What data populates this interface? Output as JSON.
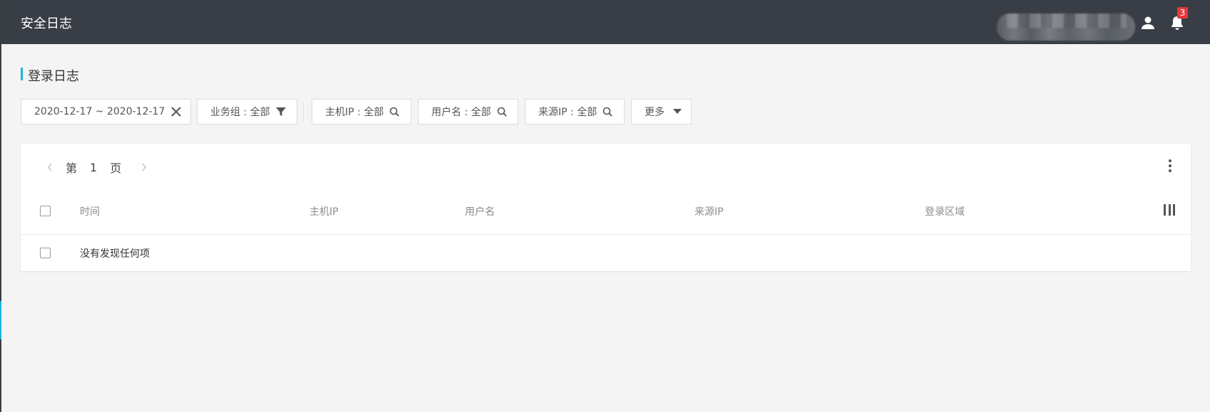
{
  "app": {
    "title": "安全日志",
    "notification_count": "3"
  },
  "page": {
    "section_title": "登录日志"
  },
  "filters": {
    "date_range": "2020-12-17 ~ 2020-12-17",
    "business_group": "业务组 : 全部",
    "host_ip": "主机IP : 全部",
    "username": "用户名 : 全部",
    "source_ip": "来源IP : 全部",
    "more": "更多"
  },
  "pager": {
    "prefix": "第",
    "page": "1",
    "suffix": "页"
  },
  "table": {
    "columns": [
      "时间",
      "主机IP",
      "用户名",
      "来源IP",
      "登录区域"
    ],
    "empty_text": "没有发现任何项"
  },
  "colors": {
    "topbar": "#393e46",
    "accent": "#16b6de",
    "badge": "#e5383b",
    "background": "#f4f4f4"
  },
  "icons": [
    "user-icon",
    "bell-icon",
    "close-icon",
    "filter-icon",
    "search-icon",
    "caret-down-icon",
    "chevron-left-icon",
    "chevron-right-icon",
    "more-vertical-icon",
    "columns-icon"
  ]
}
